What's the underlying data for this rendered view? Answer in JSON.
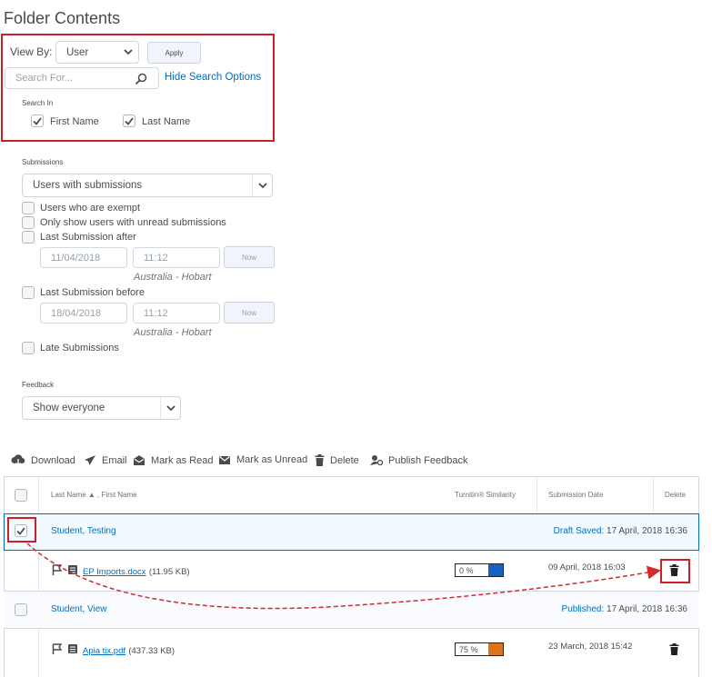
{
  "page": {
    "title": "Folder Contents"
  },
  "search_panel": {
    "view_by_label": "View By:",
    "view_by_value": "User",
    "apply_label": "Apply",
    "search_placeholder": "Search For...",
    "hide_search_options": "Hide Search Options",
    "search_in_label": "Search In",
    "first_name_label": "First Name",
    "last_name_label": "Last Name"
  },
  "submissions": {
    "label": "Submissions",
    "select_value": "Users with submissions",
    "exempt_label": "Users who are exempt",
    "unread_label": "Only show users with unread submissions",
    "after_label": "Last Submission after",
    "after_date": "11/04/2018",
    "after_time": "11:12",
    "now_label": "Now",
    "timezone": "Australia - Hobart",
    "before_label": "Last Submission before",
    "before_date": "18/04/2018",
    "before_time": "11:12",
    "late_label": "Late Submissions"
  },
  "feedback": {
    "label": "Feedback",
    "select_value": "Show everyone"
  },
  "toolbar": {
    "download": "Download",
    "email": "Email",
    "mark_read": "Mark as Read",
    "mark_unread": "Mark as Unread",
    "delete": "Delete",
    "publish_feedback": "Publish Feedback"
  },
  "table": {
    "col_name": "Last Name ▲ , First Name",
    "col_turnitin": "Turnitin® Similarity",
    "col_date": "Submission Date",
    "col_delete": "Delete",
    "rows": [
      {
        "name": "Student, Testing",
        "status_label": "Draft Saved:",
        "status_date": "17 April, 2018 16:36",
        "file_name": "EP Imports.docx",
        "file_size": "(11.95 KB)",
        "similarity": "0 %",
        "similarity_color": "#1561c4",
        "submission_date": "09 April, 2018 16:03"
      },
      {
        "name": "Student, View",
        "status_label": "Published:",
        "status_date": "17 April, 2018 16:36",
        "file_name": "Apia tix.pdf",
        "file_size": "(437.33 KB)",
        "similarity": "75 %",
        "similarity_color": "#d9731d",
        "submission_date": "23 March, 2018 15:42"
      }
    ]
  },
  "colors": {
    "highlight_red": "#cd2026",
    "link_blue": "#006fbf",
    "row_select": "#f3faff"
  }
}
